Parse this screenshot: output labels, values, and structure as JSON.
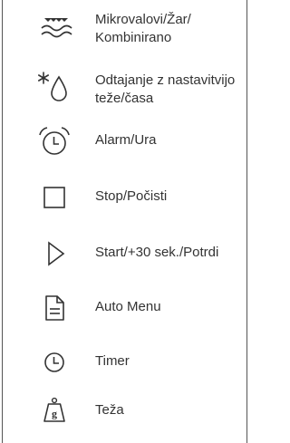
{
  "legend": {
    "items": [
      {
        "icon": "microwave-grill-icon",
        "label": "Mikrovalovi/Žar/\nKombinirano"
      },
      {
        "icon": "defrost-icon",
        "label": "Odtajanje z nastavitvijo\nteže/časa"
      },
      {
        "icon": "alarm-clock-icon",
        "label": "Alarm/Ura"
      },
      {
        "icon": "stop-square-icon",
        "label": "Stop/Počisti"
      },
      {
        "icon": "start-triangle-icon",
        "label": "Start/+30 sek./Potrdi"
      },
      {
        "icon": "auto-menu-document-icon",
        "label": "Auto Menu"
      },
      {
        "icon": "timer-clock-icon",
        "label": "Timer"
      },
      {
        "icon": "weight-g-icon",
        "label": "Teža"
      }
    ]
  }
}
